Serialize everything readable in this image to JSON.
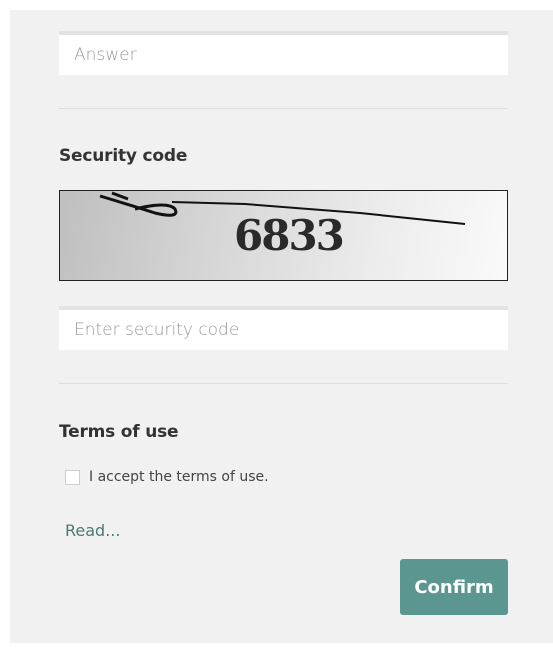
{
  "answer_field": {
    "placeholder": "Answer",
    "value": ""
  },
  "security": {
    "heading": "Security code",
    "captcha_text": "6833",
    "input_placeholder": "Enter security code",
    "input_value": ""
  },
  "terms": {
    "heading": "Terms of use",
    "checkbox_label": "I accept the terms of use.",
    "checked": false,
    "read_link": "Read..."
  },
  "actions": {
    "confirm_label": "Confirm"
  },
  "colors": {
    "panel_bg": "#f1f1f1",
    "accent": "#5b9690",
    "link": "#4a7a77"
  }
}
